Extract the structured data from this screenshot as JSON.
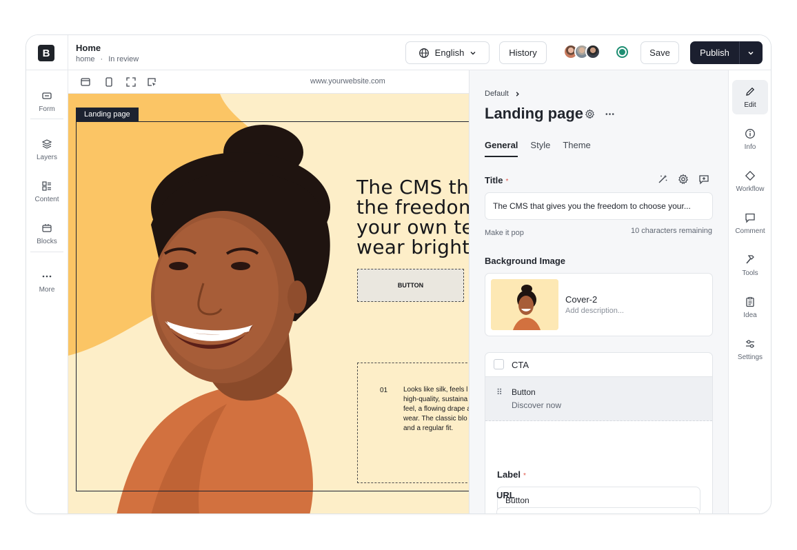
{
  "app": {
    "logo_letter": "B",
    "accent": "#1b1f2f"
  },
  "left_rail": {
    "items": [
      {
        "label": "Form",
        "icon": "form-icon"
      },
      {
        "label": "Layers",
        "icon": "layers-icon"
      },
      {
        "label": "Content",
        "icon": "content-icon"
      },
      {
        "label": "Blocks",
        "icon": "blocks-icon"
      },
      {
        "label": "More",
        "icon": "more-icon"
      }
    ]
  },
  "header": {
    "title": "Home",
    "sub_path": "home",
    "sub_separator": "·",
    "status": "In review",
    "language": "English",
    "history": "History",
    "save": "Save",
    "publish": "Publish"
  },
  "preview": {
    "url": "www.yourwebsite.com",
    "tag": "Landing page",
    "headline_lines": [
      "The CMS tha",
      "the freedom",
      "your own tec",
      "wear bright s"
    ],
    "button_text": "BUTTON",
    "item_number": "01",
    "paragraph": "Looks like silk, feels l\nhigh-quality, sustaina\nfeel, a flowing drape a\nwear. The classic blo\nand a regular fit."
  },
  "editor": {
    "breadcrumb": "Default",
    "page_title": "Landing page",
    "tabs": [
      "General",
      "Style",
      "Theme"
    ],
    "active_tab": "General",
    "title_field": {
      "label": "Title",
      "required_mark": "*",
      "value": "The CMS that gives you the freedom to choose your...",
      "hint": "Make it pop",
      "remaining": "10 characters remaining"
    },
    "background_image": {
      "label": "Background Image",
      "name": "Cover-2",
      "description_placeholder": "Add description..."
    },
    "cta": {
      "label": "CTA",
      "button_title": "Button",
      "button_subtitle": "Discover now"
    },
    "label_field": {
      "label": "Label",
      "required_mark": "*",
      "value": "Button"
    },
    "url_field": {
      "label": "URL"
    }
  },
  "right_rail": {
    "items": [
      {
        "label": "Edit",
        "icon": "pencil-icon",
        "active": true
      },
      {
        "label": "Info",
        "icon": "info-icon"
      },
      {
        "label": "Workflow",
        "icon": "diamond-icon"
      },
      {
        "label": "Comment",
        "icon": "comment-icon"
      },
      {
        "label": "Tools",
        "icon": "hammer-icon"
      },
      {
        "label": "Idea",
        "icon": "clipboard-icon"
      },
      {
        "label": "Settings",
        "icon": "sliders-icon"
      }
    ]
  }
}
